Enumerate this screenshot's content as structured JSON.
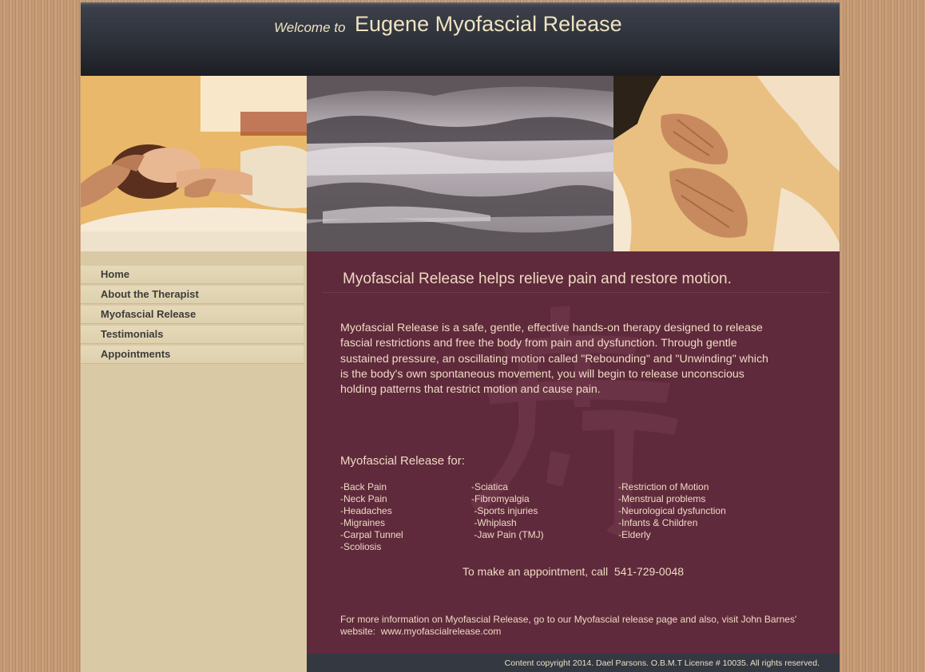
{
  "header": {
    "welcome_text": "Welcome to",
    "site_title": "Eugene Myofascial Release"
  },
  "banner": {
    "images": [
      {
        "name": "massage-head-photo"
      },
      {
        "name": "foggy-forest-photo"
      },
      {
        "name": "massage-back-photo"
      }
    ]
  },
  "nav": {
    "items": [
      {
        "label": "Home"
      },
      {
        "label": "About the Therapist"
      },
      {
        "label": "Myofascial Release"
      },
      {
        "label": "Testimonials"
      },
      {
        "label": "Appointments"
      }
    ]
  },
  "content": {
    "heading": "Myofascial Release helps relieve pain and restore motion.",
    "intro_lines": [
      "Myofascial Release is a safe, gentle, effective hands-on therapy designed to release",
      "fascial restrictions and free the body from pain and dysfunction.  Through gentle",
      "sustained pressure, an oscillating motion called \"Rebounding\" and \"Unwinding\" which",
      "is the body's own spontaneous movement, you will begin to release unconscious",
      "holding patterns that restrict motion and cause pain."
    ],
    "for_heading": "Myofascial Release for:",
    "conditions": {
      "col1": [
        "-Back Pain",
        "-Neck Pain",
        "-Headaches",
        "-Migraines",
        "-Carpal Tunnel",
        "-Scoliosis"
      ],
      "col2": [
        "-Sciatica",
        "-Fibromyalgia",
        " -Sports injuries",
        " -Whiplash",
        " -Jaw Pain (TMJ)"
      ],
      "col3": [
        "-Restriction of Motion",
        "-Menstrual problems",
        "-Neurological dysfunction",
        "-Infants & Children",
        "-Elderly"
      ]
    },
    "appointment_text": "To make an appointment, call  541-729-0048",
    "more_info_lines": [
      "For more information on Myofascial Release, go to our Myofascial release page and also, visit John Barnes'",
      "website:  www.myofascialrelease.com"
    ]
  },
  "footer": {
    "text": "Content copyright 2014. Dael Parsons. O.B.M.T License # 10035. All rights reserved."
  }
}
